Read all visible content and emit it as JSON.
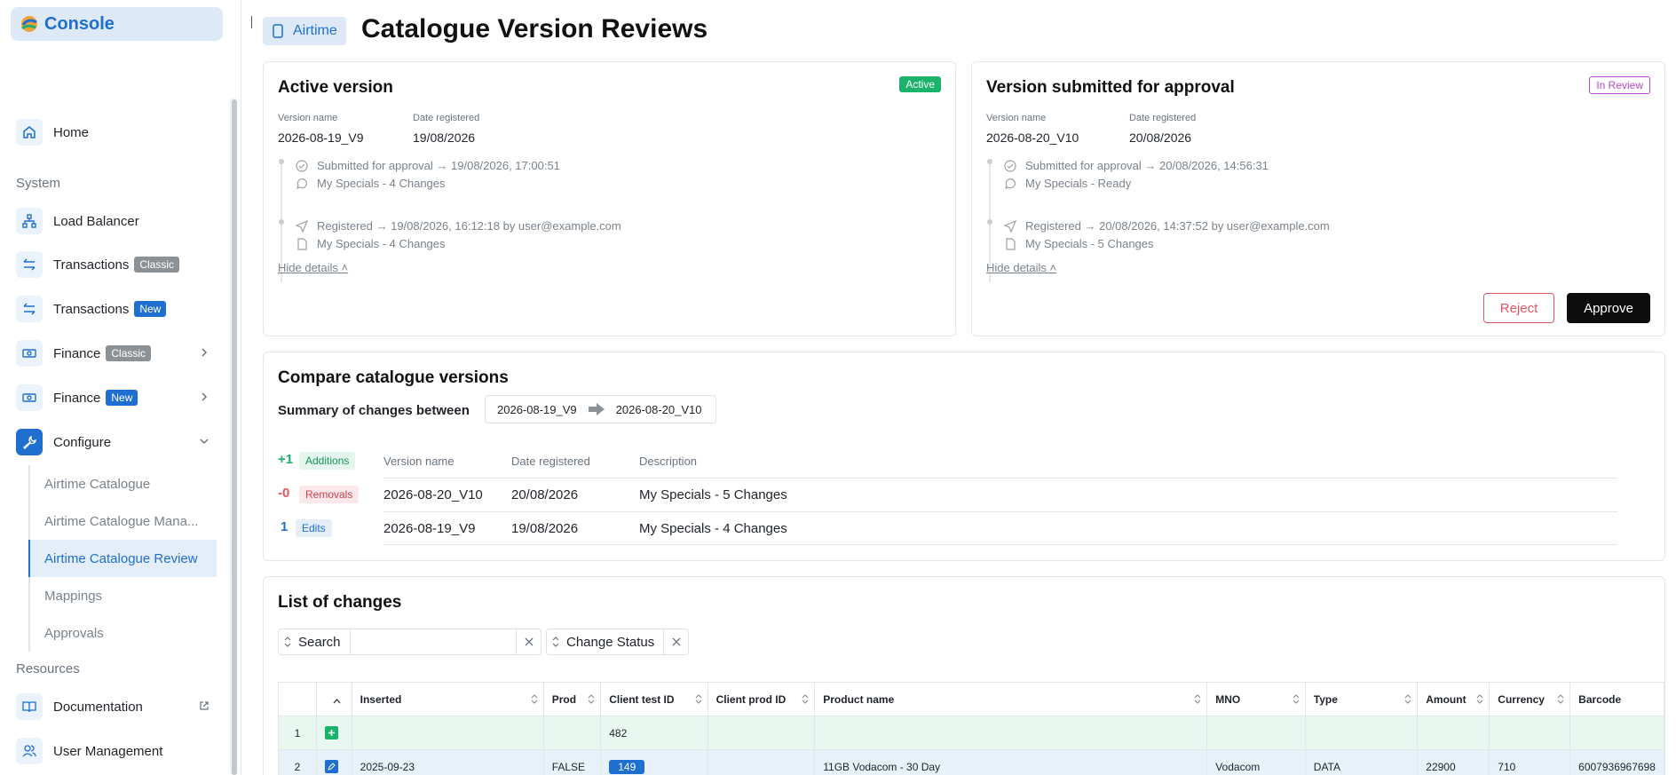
{
  "brand": {
    "name": "Console"
  },
  "sidebar": {
    "items": [
      {
        "label": "Home"
      },
      {
        "label": "Load Balancer"
      },
      {
        "label": "Transactions",
        "badge": "Classic"
      },
      {
        "label": "Transactions",
        "badge": "New"
      },
      {
        "label": "Finance",
        "badge": "Classic"
      },
      {
        "label": "Finance",
        "badge": "New"
      },
      {
        "label": "Configure"
      }
    ],
    "section_system": "System",
    "section_resources": "Resources",
    "sub_items": [
      {
        "label": "Airtime Catalogue"
      },
      {
        "label": "Airtime Catalogue Mana..."
      },
      {
        "label": "Airtime Catalogue Review"
      },
      {
        "label": "Mappings"
      },
      {
        "label": "Approvals"
      }
    ],
    "resources": [
      {
        "label": "Documentation"
      },
      {
        "label": "User Management"
      }
    ]
  },
  "header": {
    "crumb": "Airtime",
    "title": "Catalogue Version Reviews"
  },
  "active_card": {
    "title": "Active version",
    "status": "Active",
    "version_label": "Version name",
    "version_value": "2026-08-19_V9",
    "date_label": "Date registered",
    "date_value": "19/08/2026",
    "submitted": "Submitted for approval → 19/08/2026, 17:00:51",
    "submitted_note": "My Specials - 4 Changes",
    "registered": "Registered → 19/08/2026, 16:12:18 by user@example.com",
    "registered_note": "My Specials - 4 Changes",
    "hide": "Hide details"
  },
  "review_card": {
    "title": "Version submitted for approval",
    "status": "In Review",
    "version_label": "Version name",
    "version_value": "2026-08-20_V10",
    "date_label": "Date registered",
    "date_value": "20/08/2026",
    "submitted": "Submitted for approval → 20/08/2026, 14:56:31",
    "submitted_note": "My Specials - Ready",
    "registered": "Registered → 20/08/2026, 14:37:52 by user@example.com",
    "registered_note": "My Specials - 5 Changes",
    "hide": "Hide details",
    "reject": "Reject",
    "approve": "Approve"
  },
  "compare": {
    "title": "Compare catalogue versions",
    "summary_label": "Summary of changes between",
    "from": "2026-08-19_V9",
    "to": "2026-08-20_V10",
    "additions_count": "+1",
    "additions_label": "Additions",
    "removals_count": "-0",
    "removals_label": "Removals",
    "edits_count": "1",
    "edits_label": "Edits",
    "columns": [
      "Version name",
      "Date registered",
      "Description"
    ],
    "rows": [
      {
        "version": "2026-08-20_V10",
        "date": "20/08/2026",
        "desc": "My Specials - 5 Changes"
      },
      {
        "version": "2026-08-19_V9",
        "date": "19/08/2026",
        "desc": "My Specials - 4 Changes"
      }
    ]
  },
  "changes": {
    "title": "List of changes",
    "search_label": "Search",
    "search_value": "",
    "status_label": "Change Status",
    "columns": [
      "Inserted",
      "Prod",
      "Client test ID",
      "Client prod ID",
      "Product name",
      "MNO",
      "Type",
      "Amount",
      "Currency",
      "Barcode"
    ],
    "rows": [
      {
        "n": "1",
        "inserted": "",
        "prod": "",
        "test_id": "482",
        "prod_id": "",
        "name": "",
        "mno": "",
        "type": "",
        "amount": "",
        "currency": "",
        "barcode": ""
      },
      {
        "n": "2",
        "inserted": "2025-09-23",
        "prod": "FALSE",
        "test_id": "149",
        "prod_id": "",
        "name": "11GB Vodacom - 30 Day",
        "mno": "Vodacom",
        "type": "DATA",
        "amount": "22900",
        "currency": "710",
        "barcode": "6007936967698"
      }
    ]
  },
  "colors": {
    "accent": "#1f6fd1",
    "active": "#19b36b",
    "review": "#b44ac9",
    "reject": "#e25462"
  }
}
